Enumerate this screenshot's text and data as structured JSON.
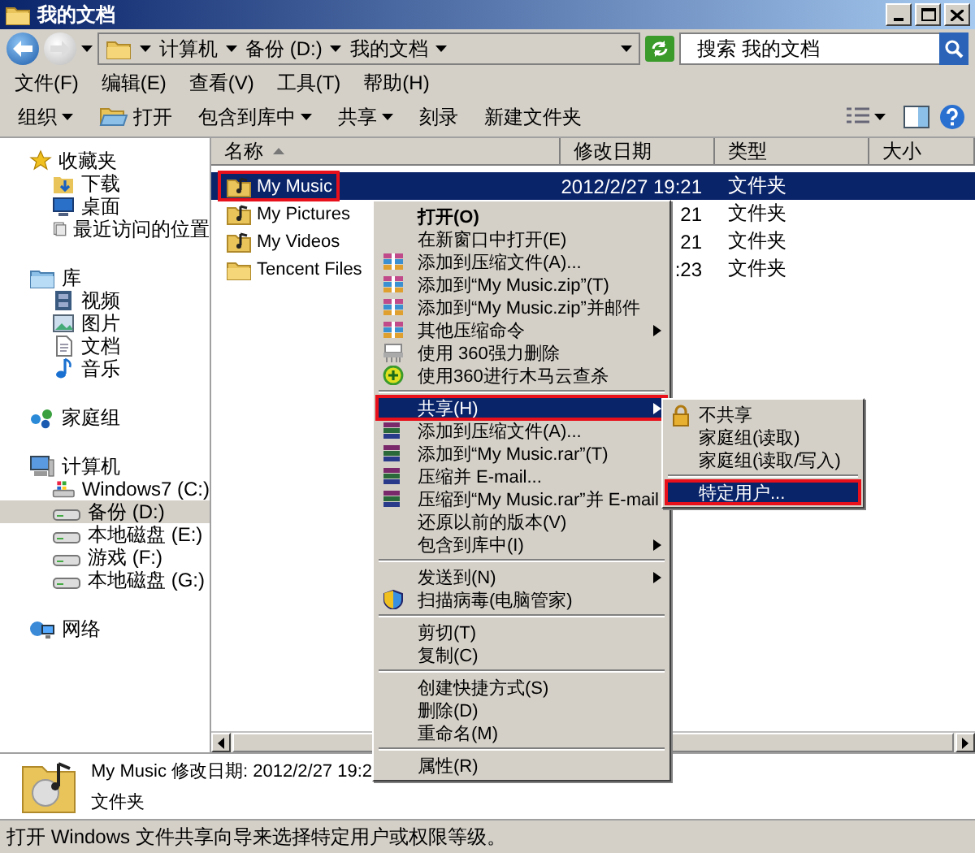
{
  "window": {
    "title": "我的文档"
  },
  "address_bar": {
    "path": [
      "计算机",
      "备份 (D:)",
      "我的文档"
    ],
    "search": {
      "placeholder": "搜索 我的文档"
    }
  },
  "menu_bar": [
    "文件(F)",
    "编辑(E)",
    "查看(V)",
    "工具(T)",
    "帮助(H)"
  ],
  "toolbar": [
    {
      "label": "组织",
      "dropdown": true
    },
    {
      "label": "打开",
      "dropdown": false
    },
    {
      "label": "包含到库中",
      "dropdown": true
    },
    {
      "label": "共享",
      "dropdown": true
    },
    {
      "label": "刻录",
      "dropdown": false
    },
    {
      "label": "新建文件夹",
      "dropdown": false
    }
  ],
  "nav": [
    {
      "label": "收藏夹",
      "selected": false,
      "children": [
        {
          "label": "下载",
          "selected": false
        },
        {
          "label": "桌面",
          "selected": false
        },
        {
          "label": "最近访问的位置",
          "selected": false
        }
      ]
    },
    {
      "label": "库",
      "selected": false,
      "children": [
        {
          "label": "视频",
          "selected": false
        },
        {
          "label": "图片",
          "selected": false
        },
        {
          "label": "文档",
          "selected": false
        },
        {
          "label": "音乐",
          "selected": false
        }
      ]
    },
    {
      "label": "家庭组",
      "selected": false
    },
    {
      "label": "计算机",
      "selected": false,
      "children": [
        {
          "label": "Windows7 (C:)",
          "selected": false
        },
        {
          "label": "备份 (D:)",
          "selected": true
        },
        {
          "label": "本地磁盘 (E:)",
          "selected": false
        },
        {
          "label": "游戏 (F:)",
          "selected": false
        },
        {
          "label": "本地磁盘 (G:)",
          "selected": false
        }
      ]
    },
    {
      "label": "网络",
      "selected": false
    }
  ],
  "file_list": {
    "columns": [
      {
        "label": "名称",
        "sorted": true
      },
      {
        "label": "修改日期",
        "sorted": false
      },
      {
        "label": "类型",
        "sorted": false
      },
      {
        "label": "大小",
        "sorted": false
      }
    ],
    "rows": [
      {
        "name": "My Music",
        "modified": "2012/2/27 19:21",
        "type": "文件夹",
        "selected": true,
        "outlined": true
      },
      {
        "name": "My Pictures",
        "modified": "21",
        "type": "文件夹",
        "selected": false,
        "outlined": false
      },
      {
        "name": "My Videos",
        "modified": "21",
        "type": "文件夹",
        "selected": false,
        "outlined": false
      },
      {
        "name": "Tencent Files",
        "modified": ":23",
        "type": "文件夹",
        "selected": false,
        "outlined": false
      }
    ]
  },
  "context_menu": {
    "items": [
      {
        "kind": "item",
        "label": "打开(O)",
        "default": true,
        "selected": false,
        "outlined": false
      },
      {
        "kind": "item",
        "label": "在新窗口中打开(E)",
        "selected": false,
        "outlined": false
      },
      {
        "kind": "zip",
        "label": "添加到压缩文件(A)...",
        "selected": false,
        "outlined": false
      },
      {
        "kind": "zip",
        "label": "添加到“My Music.zip”(T)",
        "selected": false,
        "outlined": false
      },
      {
        "kind": "zip",
        "label": "添加到“My Music.zip”并邮件",
        "selected": false,
        "outlined": false
      },
      {
        "kind": "zip",
        "label": "其他压缩命令",
        "submenu": true,
        "selected": false,
        "outlined": false
      },
      {
        "kind": "shred",
        "label": "使用 360强力删除",
        "selected": false,
        "outlined": false
      },
      {
        "kind": "scan",
        "label": "使用360进行木马云查杀",
        "selected": false,
        "outlined": false
      },
      {
        "kind": "separator"
      },
      {
        "kind": "item",
        "label": "共享(H)",
        "submenu": true,
        "selected": true,
        "outlined": true
      },
      {
        "kind": "rar",
        "label": "添加到压缩文件(A)...",
        "selected": false,
        "outlined": false
      },
      {
        "kind": "rar",
        "label": "添加到“My Music.rar”(T)",
        "selected": false,
        "outlined": false
      },
      {
        "kind": "rar",
        "label": "压缩并 E-mail...",
        "selected": false,
        "outlined": false
      },
      {
        "kind": "rar",
        "label": "压缩到“My Music.rar”并 E-mail",
        "selected": false,
        "outlined": false
      },
      {
        "kind": "item",
        "label": "还原以前的版本(V)",
        "selected": false,
        "outlined": false
      },
      {
        "kind": "item",
        "label": "包含到库中(I)",
        "submenu": true,
        "selected": false,
        "outlined": false
      },
      {
        "kind": "separator"
      },
      {
        "kind": "item",
        "label": "发送到(N)",
        "submenu": true,
        "selected": false,
        "outlined": false
      },
      {
        "kind": "shield",
        "label": "扫描病毒(电脑管家)",
        "selected": false,
        "outlined": false
      },
      {
        "kind": "separator"
      },
      {
        "kind": "item",
        "label": "剪切(T)",
        "selected": false,
        "outlined": false
      },
      {
        "kind": "item",
        "label": "复制(C)",
        "selected": false,
        "outlined": false
      },
      {
        "kind": "separator"
      },
      {
        "kind": "item",
        "label": "创建快捷方式(S)",
        "selected": false,
        "outlined": false
      },
      {
        "kind": "item",
        "label": "删除(D)",
        "selected": false,
        "outlined": false
      },
      {
        "kind": "item",
        "label": "重命名(M)",
        "selected": false,
        "outlined": false
      },
      {
        "kind": "separator"
      },
      {
        "kind": "item",
        "label": "属性(R)",
        "selected": false,
        "outlined": false
      }
    ]
  },
  "submenu": {
    "items": [
      {
        "kind": "lock",
        "label": "不共享",
        "selected": false,
        "outlined": false
      },
      {
        "kind": "item",
        "label": "家庭组(读取)",
        "selected": false,
        "outlined": false
      },
      {
        "kind": "item",
        "label": "家庭组(读取/写入)",
        "selected": false,
        "outlined": false
      },
      {
        "kind": "separator"
      },
      {
        "kind": "item",
        "label": "特定用户...",
        "selected": true,
        "outlined": true
      }
    ]
  },
  "details_pane": {
    "line_1": "My Music 修改日期: 2012/2/27 19:2",
    "line_2": "文件夹"
  },
  "status_bar": "打开 Windows 文件共享向导来选择特定用户或权限等级。"
}
